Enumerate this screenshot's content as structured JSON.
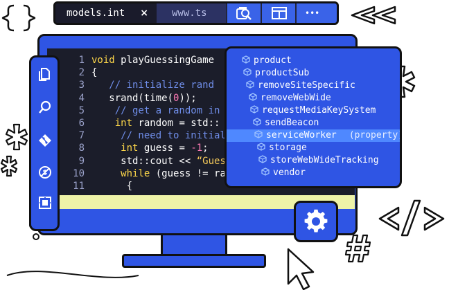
{
  "tabs": [
    {
      "label": "models.int",
      "close": "×",
      "active": true
    },
    {
      "label": "www.ts",
      "active": false
    }
  ],
  "toolbar": {
    "icons": [
      "search-replace-icon",
      "layout-icon",
      "more-icon"
    ],
    "more_glyph": "•••"
  },
  "activity_bar": {
    "icons": [
      "files-icon",
      "search-icon",
      "source-control-icon",
      "debug-icon",
      "extensions-icon"
    ]
  },
  "editor": {
    "lines": [
      {
        "n": "1",
        "segments": [
          {
            "t": "void ",
            "c": "kw"
          },
          {
            "t": "playGuessingGame",
            "c": "fn"
          }
        ]
      },
      {
        "n": "2",
        "segments": [
          {
            "t": "{",
            "c": "fn"
          }
        ]
      },
      {
        "n": "3",
        "segments": [
          {
            "t": "   // initialize rand",
            "c": "cm"
          }
        ]
      },
      {
        "n": "4",
        "segments": [
          {
            "t": "   srand(time(",
            "c": "fn"
          },
          {
            "t": "0",
            "c": "nm"
          },
          {
            "t": "));",
            "c": "fn"
          }
        ]
      },
      {
        "n": "5",
        "segments": [
          {
            "t": "    // get a random in",
            "c": "cm"
          }
        ]
      },
      {
        "n": "6",
        "segments": [
          {
            "t": "    ",
            "c": "fn"
          },
          {
            "t": "int",
            "c": "kw"
          },
          {
            "t": " random = std::",
            "c": "fn"
          }
        ]
      },
      {
        "n": "7",
        "segments": [
          {
            "t": "     // need to initial",
            "c": "cm"
          }
        ]
      },
      {
        "n": "8",
        "segments": [
          {
            "t": "     ",
            "c": "fn"
          },
          {
            "t": "int",
            "c": "kw"
          },
          {
            "t": " guess = ",
            "c": "fn"
          },
          {
            "t": "-1",
            "c": "nm"
          },
          {
            "t": ";",
            "c": "fn"
          }
        ]
      },
      {
        "n": "9",
        "segments": [
          {
            "t": "     std::cout << ",
            "c": "fn"
          },
          {
            "t": "“Gues",
            "c": "st"
          }
        ]
      },
      {
        "n": "10",
        "segments": [
          {
            "t": "     ",
            "c": "fn"
          },
          {
            "t": "while",
            "c": "kw"
          },
          {
            "t": " (guess != ra",
            "c": "fn"
          }
        ]
      },
      {
        "n": "11",
        "segments": [
          {
            "t": "      {",
            "c": "fn"
          }
        ]
      }
    ]
  },
  "suggestions": {
    "items": [
      {
        "label": "product"
      },
      {
        "label": "productSub"
      },
      {
        "label": "removeSiteSpecific"
      },
      {
        "label": "removeWebWide"
      },
      {
        "label": "requestMediaKeySystem"
      },
      {
        "label": "sendBeacon"
      },
      {
        "label": "serviceWorker",
        "detail": "(property)",
        "selected": true
      },
      {
        "label": "storage"
      },
      {
        "label": "storeWebWideTracking"
      },
      {
        "label": "vendor"
      }
    ]
  },
  "decor": {
    "braces": "{}",
    "chevrons": "<<",
    "tag": "</>",
    "hash": "#"
  },
  "colors": {
    "accent": "#2f55e4",
    "selection": "#4f88ff",
    "editor_bg": "#1b1d2a",
    "keyword": "#ffd84a",
    "comment": "#6f8de8"
  }
}
